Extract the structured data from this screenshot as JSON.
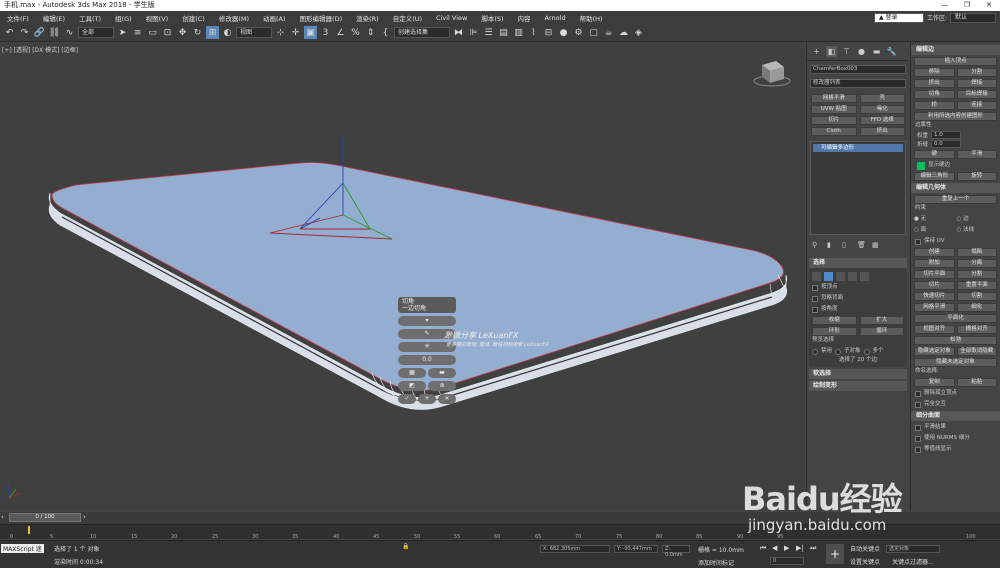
{
  "window": {
    "title": "手机.max - Autodesk 3ds Max 2018  - 学生版",
    "controls": [
      "—",
      "❐",
      "✕"
    ]
  },
  "menu": {
    "items": [
      "文件(F)",
      "编辑(E)",
      "工具(T)",
      "组(G)",
      "视图(V)",
      "创建(C)",
      "修改器(M)",
      "动画(A)",
      "图形编辑器(D)",
      "渲染(R)",
      "自定义(U)",
      "Civil View",
      "脚本(S)",
      "内容",
      "Arnold",
      "帮助(H)"
    ],
    "login": "登录",
    "workspace_label": "工作区:",
    "workspace_value": "默认"
  },
  "toolbar": {
    "selection_filter": "全部",
    "view_dropdown": "视图",
    "named_selection": "创建选择集"
  },
  "viewport": {
    "label": "[+] [透视] [DX 模式] [边框]",
    "caddy_title": "切角",
    "caddy_subtitle": "一边切角",
    "caddy_value": "0.0",
    "watermark": "渺颖分享 LeXuanFX",
    "watermark_sub": "更多精彩教程, 敬请, 微信视频搜索 LeXuanFX"
  },
  "command_panel": {
    "object_name": "ChamferBox003",
    "modifier_list": "修改器列表",
    "mod_buttons": [
      "网格平滑",
      "壳",
      "UVW 贴图",
      "噪化",
      "切片",
      "FFD 选择",
      "Cloth",
      "挤出"
    ],
    "stack_item": "可编辑多边形",
    "selection": {
      "header": "选择",
      "by_vertex": "按顶点",
      "ignore_back": "忽略背面",
      "angle": "按角度",
      "shrink": "收缩",
      "grow": "扩大",
      "ring": "环形",
      "loop": "循环",
      "preview_label": "预览选择",
      "preview_off": "禁用",
      "preview_subobj": "子对象",
      "preview_multi": "多个",
      "status": "选择了 20 个边"
    },
    "soft_selection": "软选择",
    "paint_deform": "绘制变形"
  },
  "right_panel": {
    "edit_edges_header": "编辑边",
    "insert_vertex": "插入顶点",
    "remove": "移除",
    "split": "分割",
    "extrude": "挤出",
    "weld": "焊接",
    "chamfer": "切角",
    "target_weld": "目标焊接",
    "bridge": "桥",
    "connect": "连接",
    "create_shape": "利用所选内容创建图形",
    "edge_props": "边属性",
    "weight_label": "权重",
    "weight_value": "1.0",
    "crease_label": "折缝",
    "crease_value": "0.0",
    "hard": "硬",
    "smooth": "平滑",
    "display_hard": "显示硬边",
    "edit_tri": "编辑三角形",
    "turn": "旋转",
    "edit_geo_header": "编辑几何体",
    "repeat_last": "重复上一个",
    "constraints": "约束",
    "c_none": "无",
    "c_edge": "边",
    "c_face": "面",
    "c_normal": "法线",
    "preserve_uv": "保持 UV",
    "create": "创建",
    "collapse": "塌陷",
    "attach": "附加",
    "detach": "分离",
    "slice_plane": "切片平面",
    "split2": "分割",
    "slice": "切片",
    "reset_plane": "重置平面",
    "quickslice": "快速切片",
    "cut": "切割",
    "meshsmooth": "网格平滑",
    "tessellate": "细化",
    "planarize": "平面化",
    "view_align": "视图对齐",
    "grid_align": "栅格对齐",
    "relax": "松弛",
    "hide_sel": "隐藏选定对象",
    "unhide_all": "全部取消隐藏",
    "hide_unsel": "隐藏未选定对象",
    "named_sel": "命名选择:",
    "copy": "复制",
    "paste": "粘贴",
    "delete_iso": "删除孤立顶点",
    "full_interop": "完全交互",
    "subdiv_header": "细分曲面",
    "smooth_result": "平滑结果",
    "use_nurms": "使用 NURMS 细分",
    "cage": "等值线显示"
  },
  "timeline": {
    "frame_display": "0 / 100",
    "ticks": [
      "0",
      "5",
      "10",
      "15",
      "20",
      "25",
      "30",
      "35",
      "40",
      "45",
      "50",
      "55",
      "60",
      "65",
      "70",
      "75",
      "80",
      "85",
      "90",
      "95",
      "100"
    ]
  },
  "status": {
    "maxscript": "MAXScript 迷",
    "selected": "选择了 1 个 对象",
    "render_time": "渲染时间  0:00:34",
    "x": "X: 682.305mm",
    "y": "Y: -93.447mm",
    "z": "Z: 0.0mm",
    "grid": "栅格 = 10.0mm",
    "add_time_tag": "添加时间标记",
    "auto_key": "自动关键点",
    "set_key": "设置关键点",
    "key_filter": "关键点过滤器...",
    "selected_obj": "选定对象",
    "frame": "0"
  },
  "watermark": {
    "brand": "Baidu经验",
    "url": "jingyan.baidu.com"
  }
}
